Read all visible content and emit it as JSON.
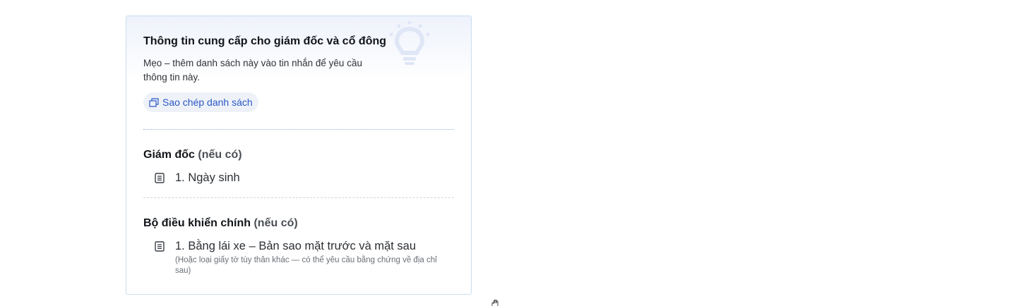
{
  "card": {
    "title": "Thông tin cung cấp cho giám đốc và cổ đông",
    "tip": "Mẹo – thêm danh sách này vào tin nhắn để yêu cầu thông tin này.",
    "copy_button": "Sao chép danh sách",
    "illustration_icon": "lightbulb-icon"
  },
  "sections": [
    {
      "title": "Giám đốc",
      "note": "(nếu có)",
      "items": [
        {
          "text": "1. Ngày sinh",
          "icon": "document-icon"
        }
      ]
    },
    {
      "title": "Bộ điều khiển chính",
      "note": "(nếu có)",
      "items": [
        {
          "text": "1. Bằng lái xe – Bản sao mặt trước và mặt sau",
          "sub": "(Hoặc loại giấy tờ tùy thân khác — có thể yêu cầu bằng chứng về địa chỉ sau)",
          "icon": "document-icon"
        }
      ]
    }
  ],
  "colors": {
    "accent": "#2a57c6",
    "card_border": "#c9def0",
    "copy_button_bg": "#eef2f8"
  }
}
